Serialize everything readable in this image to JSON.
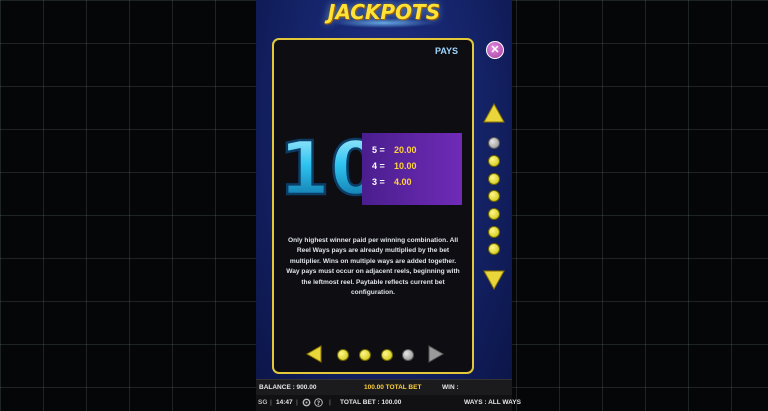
{
  "logo": {
    "text": "JACKPOTS"
  },
  "panel": {
    "title": "PAYS",
    "symbol": "10",
    "pays": [
      {
        "count": "5 =",
        "value": "20.00"
      },
      {
        "count": "4 =",
        "value": "10.00"
      },
      {
        "count": "3 =",
        "value": "4.00"
      }
    ],
    "description": "Only highest winner paid per winning combination. All Reel Ways pays are already multiplied by the bet multiplier. Wins on multiple ways are added together. Way pays must occur on adjacent reels, beginning with the leftmost reel. Paytable reflects current bet configuration."
  },
  "status": {
    "balance": "BALANCE : 900.00",
    "total_bet_center": "100.00 TOTAL BET",
    "win": "WIN :",
    "brand": "SG",
    "time": "14:47",
    "total_bet": "TOTAL BET : 100.00",
    "ways": "WAYS : ALL WAYS"
  },
  "colors": {
    "panel_border": "#e3c83a",
    "pays_band": "#6f2bb7",
    "pay_value": "#ffd23a",
    "indicator_yellow": "#fff78a",
    "indicator_gray": "#8a8a8a"
  },
  "indicators": {
    "page_total": 4,
    "page_current": 4,
    "sidebar_total": 8,
    "sidebar_current": 1
  }
}
